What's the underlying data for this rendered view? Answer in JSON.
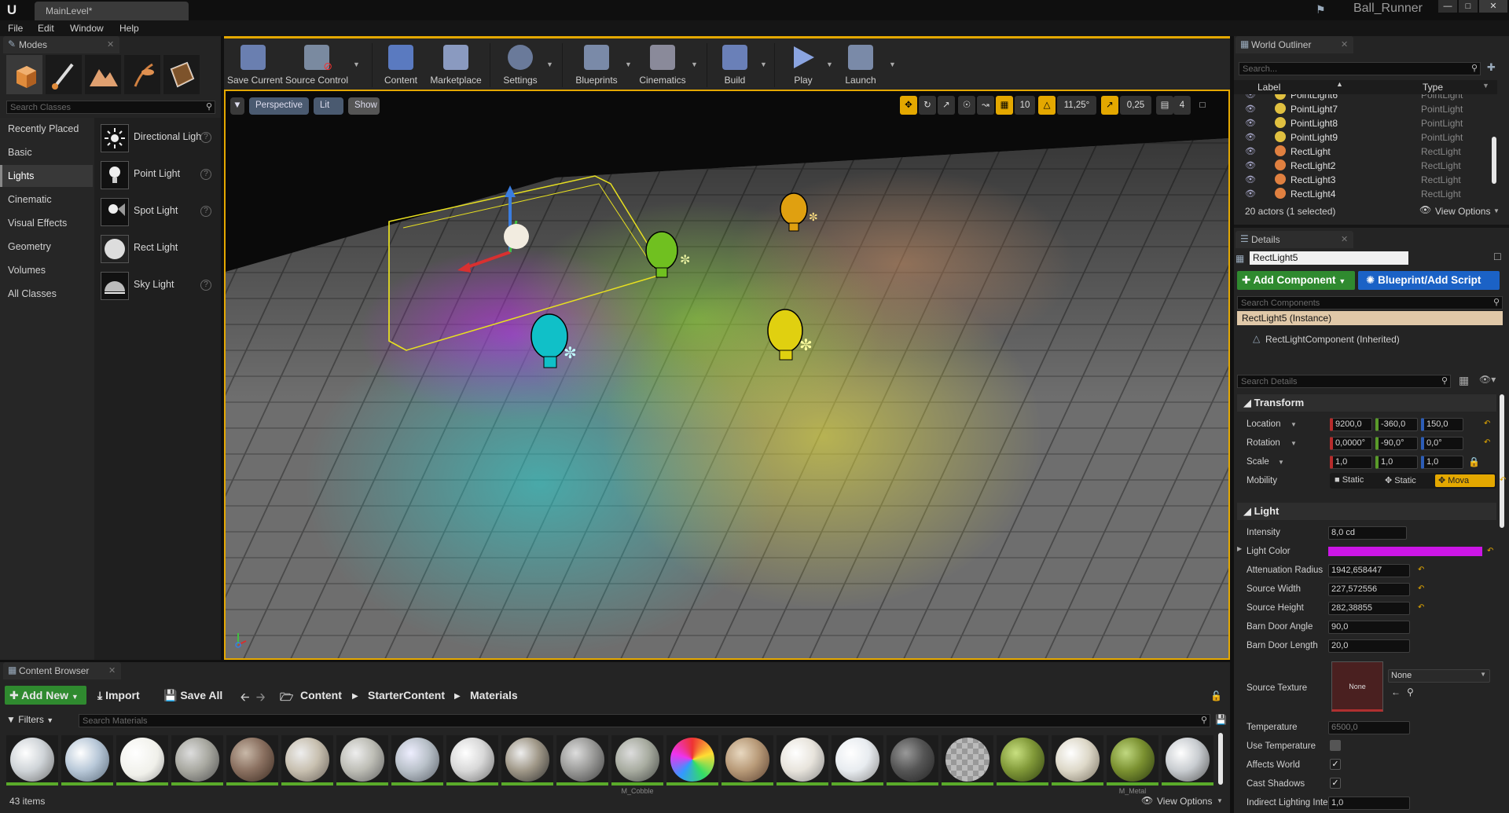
{
  "window": {
    "doc_tab": "MainLevel*",
    "project_name": "Ball_Runner",
    "menu": [
      "File",
      "Edit",
      "Window",
      "Help"
    ]
  },
  "modes": {
    "tab_title": "Modes",
    "search_placeholder": "Search Classes",
    "categories": [
      "Recently Placed",
      "Basic",
      "Lights",
      "Cinematic",
      "Visual Effects",
      "Geometry",
      "Volumes",
      "All Classes"
    ],
    "selected_category": "Lights",
    "items": [
      "Directional Light",
      "Point Light",
      "Spot Light",
      "Rect Light",
      "Sky Light"
    ]
  },
  "toolbar": {
    "buttons": [
      "Save Current",
      "Source Control",
      "Content",
      "Marketplace",
      "Settings",
      "Blueprints",
      "Cinematics",
      "Build",
      "Play",
      "Launch"
    ]
  },
  "viewport": {
    "perspective": "Perspective",
    "lit": "Lit",
    "show": "Show",
    "grid_snap": "10",
    "rotation_snap": "11,25°",
    "scale_snap": "0,25",
    "camera_speed": "4"
  },
  "outliner": {
    "tab_title": "World Outliner",
    "search_placeholder": "Search...",
    "col_label": "Label",
    "col_type": "Type",
    "rows": [
      {
        "label": "PointLight6",
        "type": "PointLight"
      },
      {
        "label": "PointLight7",
        "type": "PointLight"
      },
      {
        "label": "PointLight8",
        "type": "PointLight"
      },
      {
        "label": "PointLight9",
        "type": "PointLight"
      },
      {
        "label": "RectLight",
        "type": "RectLight"
      },
      {
        "label": "RectLight2",
        "type": "RectLight"
      },
      {
        "label": "RectLight3",
        "type": "RectLight"
      },
      {
        "label": "RectLight4",
        "type": "RectLight"
      }
    ],
    "status": "20 actors (1 selected)",
    "view_options": "View Options"
  },
  "details": {
    "tab_title": "Details",
    "name": "RectLight5",
    "add_component": "Add Component",
    "blueprint": "Blueprint/Add Script",
    "search_components": "Search Components",
    "instance": "RectLight5 (Instance)",
    "component": "RectLightComponent (Inherited)",
    "search_details": "Search Details",
    "transform_title": "Transform",
    "location_label": "Location",
    "location": [
      "9200,0",
      "-360,0",
      "150,0"
    ],
    "rotation_label": "Rotation",
    "rotation": [
      "0,0000°",
      "-90,0°",
      "0,0°"
    ],
    "scale_label": "Scale",
    "scale": [
      "1,0",
      "1,0",
      "1,0"
    ],
    "mobility_label": "Mobility",
    "mobility": [
      "Static",
      "Static",
      "Mova"
    ],
    "light_title": "Light",
    "props": [
      {
        "label": "Intensity",
        "value": "8,0 cd"
      },
      {
        "label": "Light Color",
        "value": ""
      },
      {
        "label": "Attenuation Radius",
        "value": "1942,658447"
      },
      {
        "label": "Source Width",
        "value": "227,572556"
      },
      {
        "label": "Source Height",
        "value": "282,38855"
      },
      {
        "label": "Barn Door Angle",
        "value": "90,0"
      },
      {
        "label": "Barn Door Length",
        "value": "20,0"
      }
    ],
    "source_texture_label": "Source Texture",
    "source_texture_thumb": "None",
    "source_texture_value": "None",
    "temperature_label": "Temperature",
    "temperature": "6500,0",
    "use_temperature": "Use Temperature",
    "affects_world": "Affects World",
    "cast_shadows": "Cast Shadows",
    "indirect": "Indirect Lighting Inte",
    "indirect_value": "1,0",
    "light_color_hex": "#cc16e6"
  },
  "content_browser": {
    "tab_title": "Content Browser",
    "add_new": "Add New",
    "import": "Import",
    "save_all": "Save All",
    "path": [
      "Content",
      "StarterContent",
      "Materials"
    ],
    "filters": "Filters",
    "search_placeholder": "Search Materials",
    "item_count": "43 items",
    "view_options": "View Options",
    "visible_labels": [
      "M_Cobble",
      "M_Metal"
    ]
  }
}
